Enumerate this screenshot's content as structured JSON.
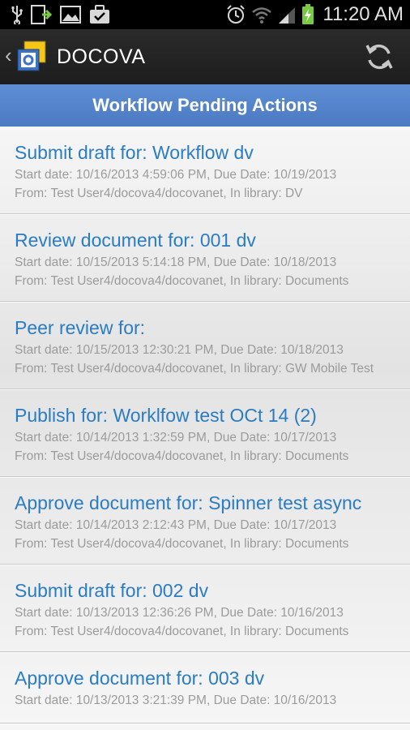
{
  "statusbar": {
    "time": "11:20 AM",
    "icons": [
      "usb-icon",
      "download-icon",
      "image-icon",
      "briefcase-icon",
      "alarm-icon",
      "wifi-icon",
      "signal-icon",
      "battery-icon"
    ]
  },
  "appbar": {
    "title": "DOCOVA",
    "icons": [
      "back-chevron-icon",
      "docova-logo-icon",
      "refresh-icon"
    ]
  },
  "header": {
    "title": "Workflow Pending Actions"
  },
  "colors": {
    "accent": "#2a7cc4",
    "header_bg": "#5585cc",
    "meta_text": "#9b9b9b"
  },
  "items": [
    {
      "title": "Submit draft for: Workflow dv",
      "dates": "Start date: 10/16/2013 4:59:06 PM, Due Date: 10/19/2013",
      "from": "From: Test User4/docova4/docovanet, In library: DV"
    },
    {
      "title": "Review document for: 001 dv",
      "dates": "Start date: 10/15/2013 5:14:18 PM, Due Date: 10/18/2013",
      "from": "From: Test User4/docova4/docovanet, In library: Documents"
    },
    {
      "title": "Peer review for:",
      "dates": "Start date: 10/15/2013 12:30:21 PM, Due Date: 10/18/2013",
      "from": "From: Test User4/docova4/docovanet, In library: GW Mobile Test"
    },
    {
      "title": "Publish for: Worklfow test OCt 14 (2)",
      "dates": "Start date: 10/14/2013 1:32:59 PM, Due Date: 10/17/2013",
      "from": "From: Test User4/docova4/docovanet, In library: Documents"
    },
    {
      "title": "Approve document for: Spinner test async",
      "dates": "Start date: 10/14/2013 2:12:43 PM, Due Date: 10/17/2013",
      "from": "From: Test User4/docova4/docovanet, In library: Documents"
    },
    {
      "title": "Submit draft for: 002 dv",
      "dates": "Start date: 10/13/2013 12:36:26 PM, Due Date: 10/16/2013",
      "from": "From: Test User4/docova4/docovanet, In library: Documents"
    },
    {
      "title": "Approve document for: 003 dv",
      "dates": "Start date: 10/13/2013 3:21:39 PM, Due Date: 10/16/2013",
      "from": ""
    }
  ]
}
